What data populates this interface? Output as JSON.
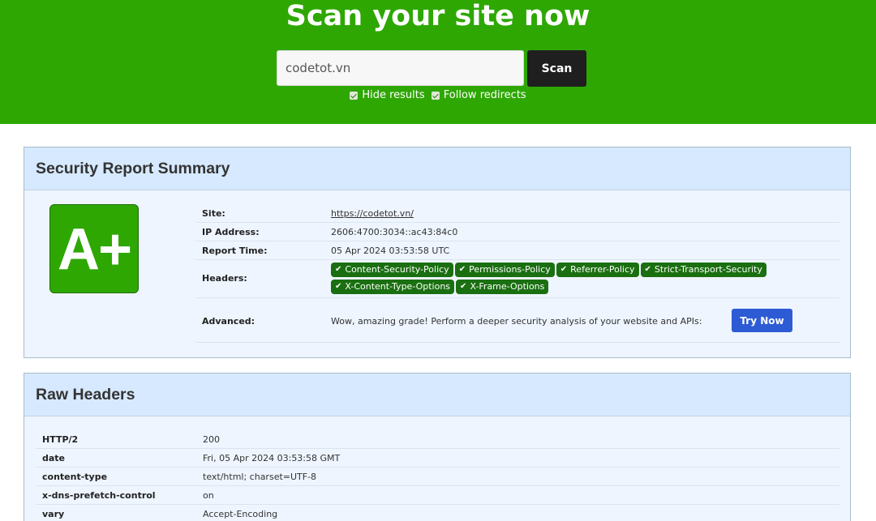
{
  "hero": {
    "title": "Scan your site now",
    "input_value": "codetot.vn",
    "scan_label": "Scan",
    "options": [
      {
        "label": "Hide results",
        "checked": true
      },
      {
        "label": "Follow redirects",
        "checked": true
      }
    ]
  },
  "summary": {
    "title": "Security Report Summary",
    "grade": "A+",
    "site_label": "Site:",
    "site_value": "https://codetot.vn/",
    "ip_label": "IP Address:",
    "ip_value": "2606:4700:3034::ac43:84c0",
    "time_label": "Report Time:",
    "time_value": "05 Apr 2024 03:53:58 UTC",
    "headers_label": "Headers:",
    "headers": [
      "Content-Security-Policy",
      "Permissions-Policy",
      "Referrer-Policy",
      "Strict-Transport-Security",
      "X-Content-Type-Options",
      "X-Frame-Options"
    ],
    "advanced_label": "Advanced:",
    "advanced_text": "Wow, amazing grade! Perform a deeper security analysis of your website and APIs:",
    "try_label": "Try Now"
  },
  "raw": {
    "title": "Raw Headers",
    "rows": [
      {
        "name": "HTTP/2",
        "value": "200"
      },
      {
        "name": "date",
        "value": "Fri, 05 Apr 2024 03:53:58 GMT"
      },
      {
        "name": "content-type",
        "value": "text/html; charset=UTF-8"
      },
      {
        "name": "x-dns-prefetch-control",
        "value": "on"
      },
      {
        "name": "vary",
        "value": "Accept-Encoding"
      }
    ]
  },
  "colors": {
    "brand_green": "#2ea703",
    "badge_green": "#1a6f10",
    "panel_header": "#d6e9ff",
    "try_blue": "#2c5bd4"
  }
}
